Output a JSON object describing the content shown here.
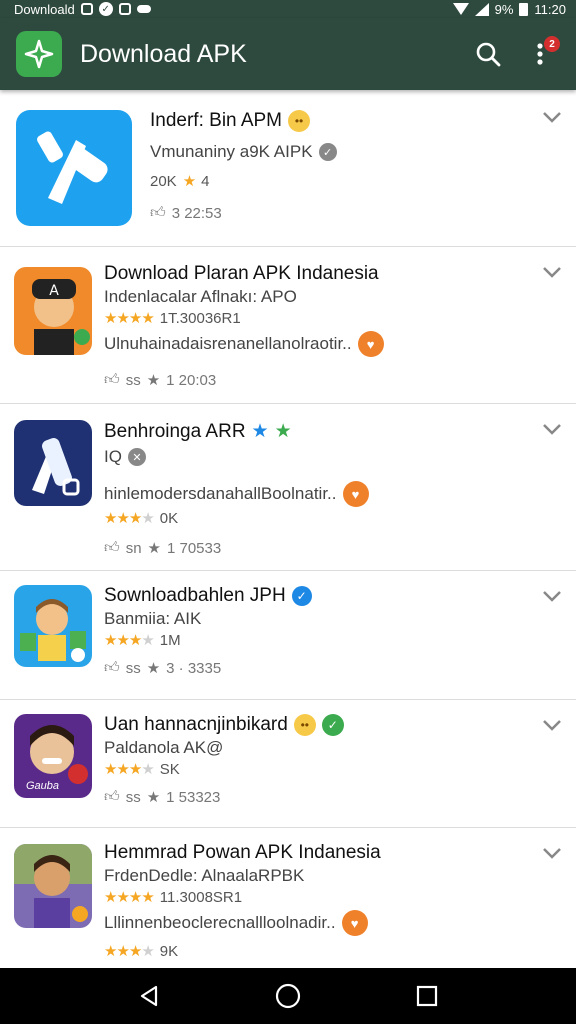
{
  "status_bar": {
    "left_text": "Downloald",
    "right_battery": "9%",
    "time": "11:20"
  },
  "app_bar": {
    "title": "Download APK",
    "notification_count": "2",
    "colors": {
      "bar": "#2e4a3e",
      "logo": "#3cab4f"
    }
  },
  "apps": [
    {
      "title": "Inderf: Bin APM",
      "subtitle": "Vmunaniny a9K AIPK",
      "rating_text": "20K",
      "rating_value": "4",
      "meta_time": "3 22:53",
      "icon": "blue-wrench-app-icon"
    },
    {
      "title": "Download Plaran APK Indanesia",
      "subtitle": "Indenlacalar Aflnakı: APO",
      "rating_text": "1T.30036R1",
      "description": "Ulnuhainadaisrenanellanolraotir..",
      "meta_count": "ss",
      "meta_time": "1 20:03",
      "icon": "orange-avatar-app-icon"
    },
    {
      "title": "Benhroinga ARR",
      "subtitle": "IQ",
      "description": "hinlemodersdanahallBoolnatir..",
      "rating_text": "0K",
      "meta_count": "sn",
      "meta_time": "1 70533",
      "icon": "navy-tool-app-icon"
    },
    {
      "title": "Sownloadbahlen JPH",
      "subtitle": "Banmiia: AIK",
      "rating_text": "1M",
      "meta_count": "ss",
      "meta_time": "3 · 3335",
      "icon": "kid-cartoon-app-icon"
    },
    {
      "title": "Uan hannacnjinbikard",
      "subtitle": "Paldanola AK@",
      "rating_text": "SK",
      "meta_count": "ss",
      "meta_time": "1 53323",
      "icon": "purple-portrait-app-icon",
      "icon_caption": "Gauba"
    },
    {
      "title": "Hemmrad Powan APK Indanesia",
      "subtitle": "FrdenDedle: AlnaalaRPBK",
      "rating_text": "11.3008SR1",
      "description": "Lllinnenbeoclerecnallloolnadir..",
      "rating_text_2": "9K",
      "icon": "man-cartoon-app-icon"
    }
  ]
}
